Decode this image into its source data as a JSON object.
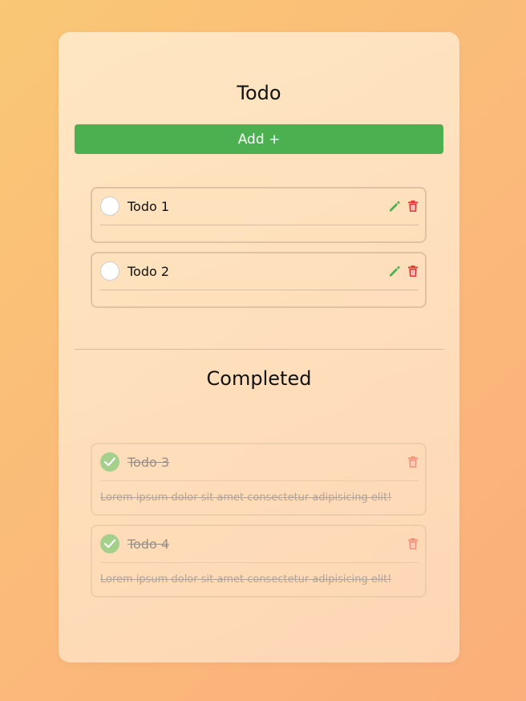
{
  "todo": {
    "title": "Todo",
    "add_label": "Add +",
    "items": [
      {
        "label": "Todo 1"
      },
      {
        "label": "Todo 2"
      }
    ]
  },
  "completed": {
    "title": "Completed",
    "items": [
      {
        "label": "Todo 3",
        "description": "Lorem ipsum dolor sit amet consectetur adipisicing elit!"
      },
      {
        "label": "Todo 4",
        "description": "Lorem ipsum dolor sit amet consectetur adipisicing elit!"
      }
    ]
  },
  "icons": {
    "edit": "pencil-icon",
    "delete": "trash-icon",
    "done": "check-icon"
  },
  "colors": {
    "accent_green": "#4caf50",
    "edit_green": "#4caf50",
    "delete_red": "#e53935",
    "check_done": "#a5d08c"
  }
}
